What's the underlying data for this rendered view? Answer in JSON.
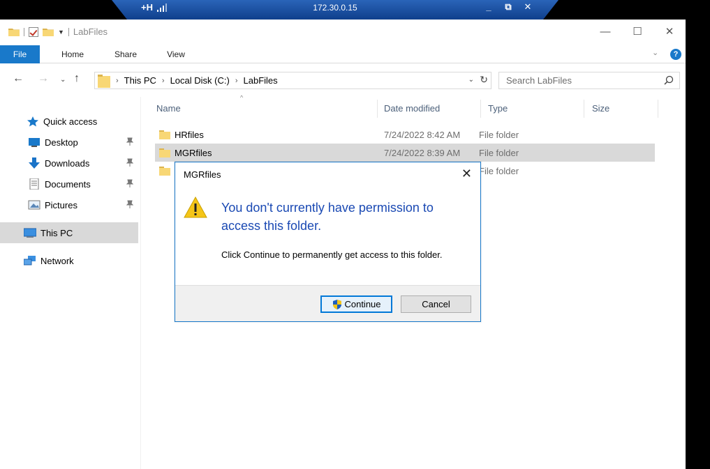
{
  "remote_bar": {
    "host": "172.30.0.15",
    "pin_glyph": "+H",
    "min_glyph": "_",
    "restore_glyph": "⧉",
    "close_glyph": "✕"
  },
  "window": {
    "title": "LabFiles",
    "min_glyph": "—",
    "max_glyph": "☐",
    "close_glyph": "✕"
  },
  "ribbon": {
    "tabs": [
      "File",
      "Home",
      "Share",
      "View"
    ],
    "help_glyph": "?"
  },
  "navbar": {
    "breadcrumb": [
      "This PC",
      "Local Disk (C:)",
      "LabFiles"
    ],
    "search_placeholder": "Search LabFiles"
  },
  "sidebar": {
    "quick_access": "Quick access",
    "pinned": [
      "Desktop",
      "Downloads",
      "Documents",
      "Pictures"
    ],
    "this_pc": "This PC",
    "network": "Network"
  },
  "filelist": {
    "columns": [
      "Name",
      "Date modified",
      "Type",
      "Size"
    ],
    "rows": [
      {
        "name": "HRfiles",
        "date": "7/24/2022 8:42 AM",
        "type": "File folder"
      },
      {
        "name": "MGRfiles",
        "date": "7/24/2022 8:39 AM",
        "type": "File folder"
      },
      {
        "name": "",
        "date": "",
        "type": "File folder"
      }
    ]
  },
  "dialog": {
    "title": "MGRfiles",
    "main_text": "You don't currently have permission to access this folder.",
    "sub_text": "Click Continue to permanently get access to this folder.",
    "continue_label": "Continue",
    "cancel_label": "Cancel"
  },
  "colors": {
    "accent": "#1979ca",
    "dialog_heading": "#1a49b3",
    "folder": "#f8d775",
    "selection": "#d9d9d9"
  }
}
